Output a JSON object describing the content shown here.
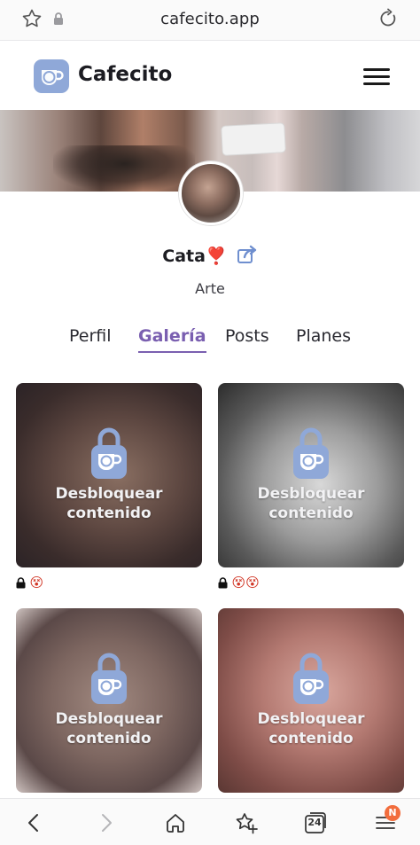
{
  "browser": {
    "url": "cafecito.app",
    "tabs_count": "24",
    "notification_badge": "N"
  },
  "header": {
    "brand": "Cafecito",
    "logo_color": "#8fa8d8"
  },
  "profile": {
    "name": "Cata",
    "name_emoji": "❣️",
    "category": "Arte"
  },
  "tabs": [
    {
      "label": "Perfil",
      "active": false
    },
    {
      "label": "Galería",
      "active": true
    },
    {
      "label": "Posts",
      "active": false
    },
    {
      "label": "Planes",
      "active": false
    }
  ],
  "gallery": {
    "unlock_label_line1": "Desbloquear",
    "unlock_label_line2": "contenido",
    "items": [
      {
        "emojis": "😵"
      },
      {
        "emojis": "😵😵"
      },
      {
        "emojis": ""
      },
      {
        "emojis": ""
      }
    ]
  },
  "colors": {
    "accent": "#7a5fb0",
    "icon_blue": "#8fa8d8",
    "badge": "#f26d3d"
  },
  "icons": {
    "top_left": "star-icon",
    "secure": "lock-icon",
    "reload": "reload-icon",
    "menu": "hamburger-icon",
    "share": "share-icon",
    "card": "unlock-cup-icon",
    "nav": [
      "back-icon",
      "forward-icon",
      "home-icon",
      "bookmark-star-icon",
      "tabs-icon",
      "menu-icon"
    ]
  }
}
